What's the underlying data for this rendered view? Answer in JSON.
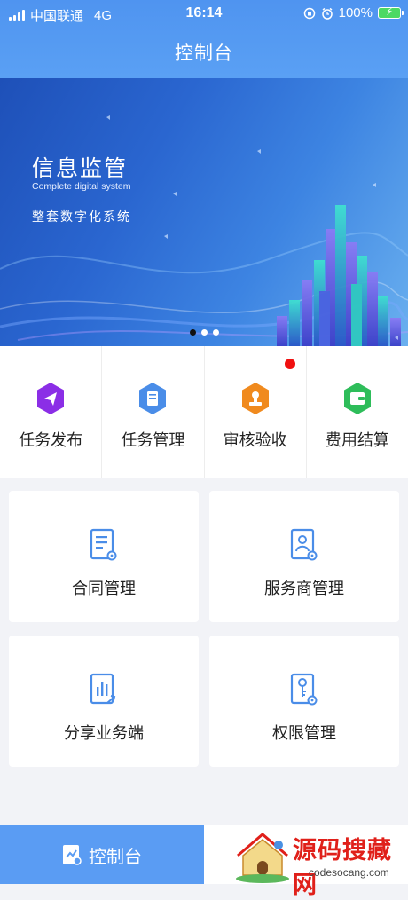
{
  "status_bar": {
    "carrier": "中国联通",
    "network": "4G",
    "time": "16:14",
    "battery": "100%"
  },
  "header": {
    "title": "控制台"
  },
  "banner": {
    "title": "信息监管",
    "subtitle": "Complete digital system",
    "slogan": "整套数字化系统",
    "active_dot": 0
  },
  "quick_actions": [
    {
      "label": "任务发布",
      "icon": "send-icon",
      "color": "#8b2ee6"
    },
    {
      "label": "任务管理",
      "icon": "book-icon",
      "color": "#4a8de8"
    },
    {
      "label": "审核验收",
      "icon": "stamp-icon",
      "color": "#f08a1e",
      "badge": true
    },
    {
      "label": "费用结算",
      "icon": "wallet-icon",
      "color": "#2ebd5a"
    }
  ],
  "cards": [
    {
      "label": "合同管理",
      "icon": "contract-icon"
    },
    {
      "label": "服务商管理",
      "icon": "provider-icon"
    },
    {
      "label": "分享业务端",
      "icon": "chart-share-icon"
    },
    {
      "label": "权限管理",
      "icon": "key-icon"
    }
  ],
  "tabbar": {
    "active_label": "控制台",
    "watermark_text": "源码搜藏网",
    "watermark_url": "codesocang.com"
  },
  "colors": {
    "header": "#5a9cf3",
    "accent": "#4a8de8",
    "badge": "#f01010"
  }
}
